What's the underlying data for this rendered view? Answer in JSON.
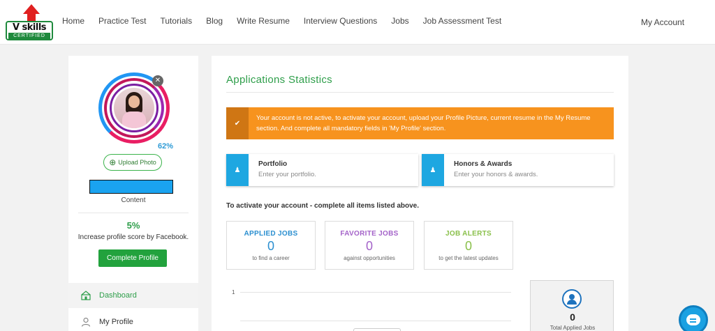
{
  "header": {
    "logo_text": "V skills",
    "logo_sub": "CERTIFIED",
    "nav": [
      "Home",
      "Practice Test",
      "Tutorials",
      "Blog",
      "Write Resume",
      "Interview Questions",
      "Jobs",
      "Job Assessment Test"
    ],
    "account_label": "My Account"
  },
  "sidebar": {
    "profile_percent": "62%",
    "upload_label": "Upload Photo",
    "name_caption": "Content",
    "facebook_percent": "5%",
    "facebook_text": "Increase profile score by Facebook.",
    "complete_label": "Complete Profile",
    "menu": [
      {
        "label": "Dashboard",
        "icon": "dashboard-icon",
        "active": true
      },
      {
        "label": "My Profile",
        "icon": "user-icon",
        "active": false
      }
    ],
    "colors": {
      "accent": "#2e9e4a",
      "name_redaction": "#1aa3f0"
    }
  },
  "main": {
    "title": "Applications Statistics",
    "alert_text": "Your account is not active, to activate your account, upload your Profile Picture, current resume in the My Resume section. And complete all mandatory fields in 'My Profile' section.",
    "alert_icon": "check-icon",
    "cards": [
      {
        "title": "Portfolio",
        "subtitle": "Enter your portfolio.",
        "icon": "user-icon"
      },
      {
        "title": "Honors & Awards",
        "subtitle": "Enter your honors & awards.",
        "icon": "user-icon"
      }
    ],
    "activate_note": "To activate your account - complete all items listed above.",
    "stats": [
      {
        "label": "APPLIED JOBS",
        "value": "0",
        "sub": "to find a career",
        "color": "#2b8fd0"
      },
      {
        "label": "FAVORITE JOBS",
        "value": "0",
        "sub": "against opportunities",
        "color": "#a463c9"
      },
      {
        "label": "JOB ALERTS",
        "value": "0",
        "sub": "to get the latest updates",
        "color": "#8ac04b"
      }
    ],
    "chart_tick": "1",
    "total": {
      "value": "0",
      "label": "Total Applied Jobs",
      "icon": "users-icon"
    },
    "colors": {
      "alert": "#f7931e",
      "card_icon": "#1ea7e1"
    }
  },
  "chat": {
    "icon": "chat-icon"
  }
}
